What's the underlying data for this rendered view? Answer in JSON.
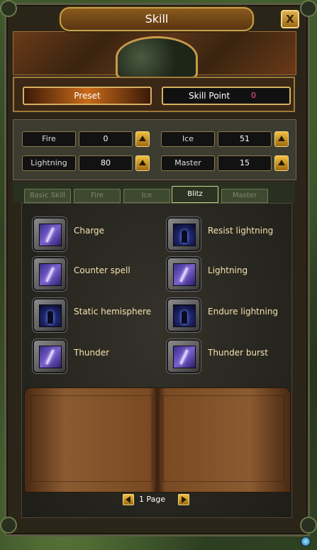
{
  "window": {
    "title": "Skill",
    "close": "X"
  },
  "top": {
    "preset_label": "Preset",
    "skill_point_label": "Skill Point",
    "skill_point_value": "0"
  },
  "stats": [
    {
      "name": "Fire",
      "value": "0"
    },
    {
      "name": "Ice",
      "value": "51"
    },
    {
      "name": "Lightning",
      "value": "80"
    },
    {
      "name": "Master",
      "value": "15"
    }
  ],
  "tabs": [
    {
      "label": "Basic Skill"
    },
    {
      "label": "Fire"
    },
    {
      "label": "Ice"
    },
    {
      "label": "Blitz"
    },
    {
      "label": "Master"
    }
  ],
  "skills": {
    "left": [
      {
        "name": "Charge",
        "icon": "bolt-icon"
      },
      {
        "name": "Counter spell",
        "icon": "bolt-icon"
      },
      {
        "name": "Static hemisphere",
        "icon": "figure-icon"
      },
      {
        "name": "Thunder",
        "icon": "bolt-icon"
      }
    ],
    "right": [
      {
        "name": "Resist lightning",
        "icon": "figure-icon"
      },
      {
        "name": "Lightning",
        "icon": "bolt-icon"
      },
      {
        "name": "Endure lightning",
        "icon": "figure-icon"
      },
      {
        "name": "Thunder burst",
        "icon": "bolt-icon"
      }
    ]
  },
  "pager": {
    "text": "1 Page"
  },
  "colors": {
    "skill_point_value": "#ff5aa0",
    "title_border": "#c9a24a"
  }
}
